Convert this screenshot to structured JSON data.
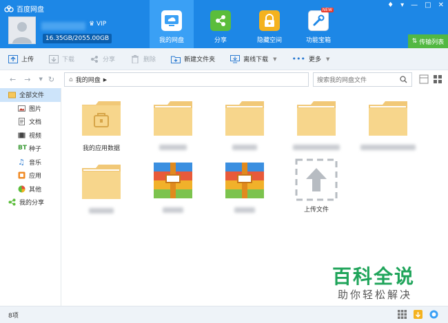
{
  "header": {
    "app_title": "百度网盘",
    "vip_label": "VIP",
    "quota": "16.35GB/2055.00GB",
    "transfer_list": "传输列表",
    "tabs": [
      {
        "label": "我的网盘",
        "icon": "cloud-drive-icon",
        "active": true
      },
      {
        "label": "分享",
        "icon": "share-icon",
        "active": false
      },
      {
        "label": "隐藏空间",
        "icon": "lock-icon",
        "active": false
      },
      {
        "label": "功能宝箱",
        "icon": "toolbox-icon",
        "active": false,
        "badge": "NEW"
      }
    ]
  },
  "toolbar": {
    "upload": "上传",
    "download": "下载",
    "share": "分享",
    "delete": "删除",
    "new_folder": "新建文件夹",
    "offline_download": "离线下载",
    "more": "更多"
  },
  "address": {
    "path": "我的网盘",
    "search_placeholder": "搜索我的网盘文件"
  },
  "sidebar": {
    "all_files": "全部文件",
    "items": [
      {
        "label": "图片",
        "icon": "image-icon"
      },
      {
        "label": "文档",
        "icon": "document-icon"
      },
      {
        "label": "视频",
        "icon": "video-icon"
      },
      {
        "label": "种子",
        "icon": "torrent-icon"
      },
      {
        "label": "音乐",
        "icon": "music-icon"
      },
      {
        "label": "应用",
        "icon": "app-icon"
      },
      {
        "label": "其他",
        "icon": "other-icon"
      }
    ],
    "my_share": "我的分享"
  },
  "files": {
    "app_data_folder": "我的应用数据",
    "upload_file": "上传文件"
  },
  "status": {
    "count": "8项"
  },
  "watermark": {
    "title": "百科全说",
    "subtitle": "助你轻松解决"
  },
  "colors": {
    "header_blue": "#1d87e6",
    "active_tab": "#3aa0f5",
    "transfer_green": "#52b842",
    "folder": "#f7d68c"
  }
}
